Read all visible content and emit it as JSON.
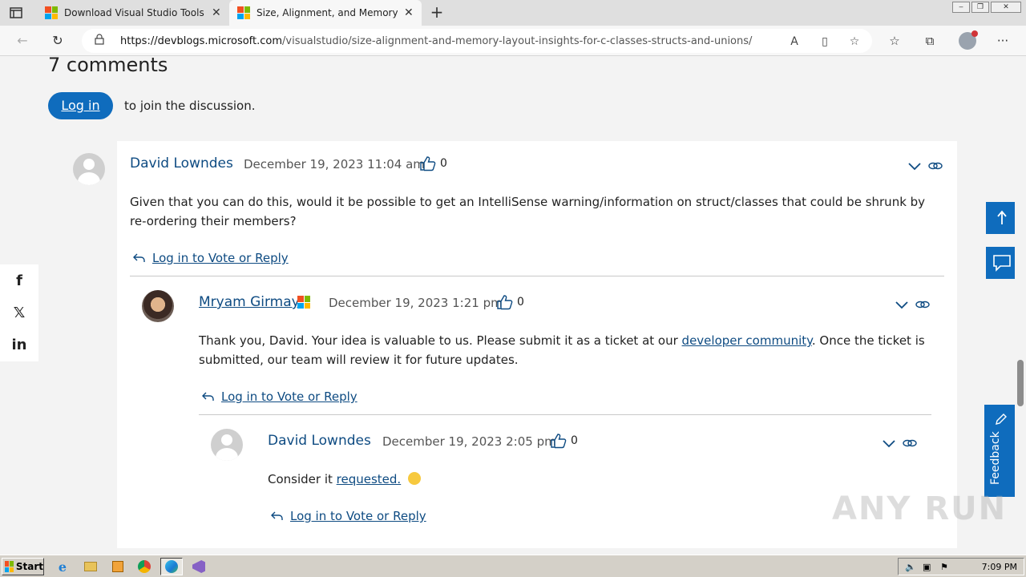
{
  "browser": {
    "tabs": [
      {
        "title": "Download Visual Studio Tools - In",
        "active": false
      },
      {
        "title": "Size, Alignment, and Memory Lay",
        "active": true
      }
    ],
    "url_host": "https://devblogs.microsoft.com",
    "url_path": "/visualstudio/size-alignment-and-memory-layout-insights-for-c-classes-structs-and-unions/"
  },
  "page": {
    "comments_title": "7 comments",
    "login_label": "Log in",
    "join_text": "to join the discussion.",
    "comments": [
      {
        "author": "David Lowndes",
        "date": "December 19, 2023 11:04 am",
        "likes": "0",
        "body": "Given that you can do this, would it be possible to get an IntelliSense warning/information on struct/classes that could be shrunk by re-ordering their members?",
        "reply_label": "Log in to Vote or Reply"
      },
      {
        "author": "Mryam Girmay",
        "date": "December 19, 2023 1:21 pm",
        "likes": "0",
        "body_before": "Thank you, David. Your idea is valuable to us. Please submit it as a ticket at our ",
        "body_link": "developer community",
        "body_after": ". Once the ticket is submitted, our team will review it for future updates.",
        "reply_label": "Log in to Vote or Reply"
      },
      {
        "author": "David Lowndes",
        "date": "December 19, 2023 2:05 pm",
        "likes": "0",
        "body_before": "Consider it ",
        "body_link": "requested.",
        "reply_label": "Log in to Vote or Reply"
      }
    ],
    "feedback_label": "Feedback",
    "watermark": "ANY RUN"
  },
  "taskbar": {
    "start_label": "Start",
    "clock": "7:09 PM"
  },
  "colors": {
    "accent": "#0f6cbd",
    "link": "#0e4b82"
  }
}
